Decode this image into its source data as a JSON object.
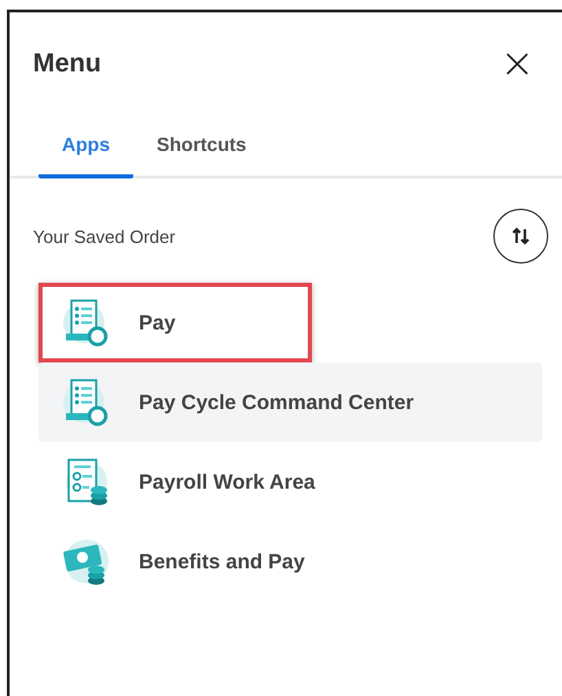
{
  "header": {
    "title": "Menu",
    "close": "×"
  },
  "tabs": [
    {
      "label": "Apps",
      "selected": true
    },
    {
      "label": "Shortcuts",
      "selected": false
    }
  ],
  "section": {
    "title": "Your Saved Order"
  },
  "apps": [
    {
      "label": "Pay",
      "kind": "payslip",
      "outlined": true,
      "hovered": false
    },
    {
      "label": "Pay Cycle Command Center",
      "kind": "payslip",
      "outlined": false,
      "hovered": true
    },
    {
      "label": "Payroll Work Area",
      "kind": "payroll",
      "outlined": false,
      "hovered": false
    },
    {
      "label": "Benefits and Pay",
      "kind": "money",
      "outlined": false,
      "hovered": false
    }
  ]
}
